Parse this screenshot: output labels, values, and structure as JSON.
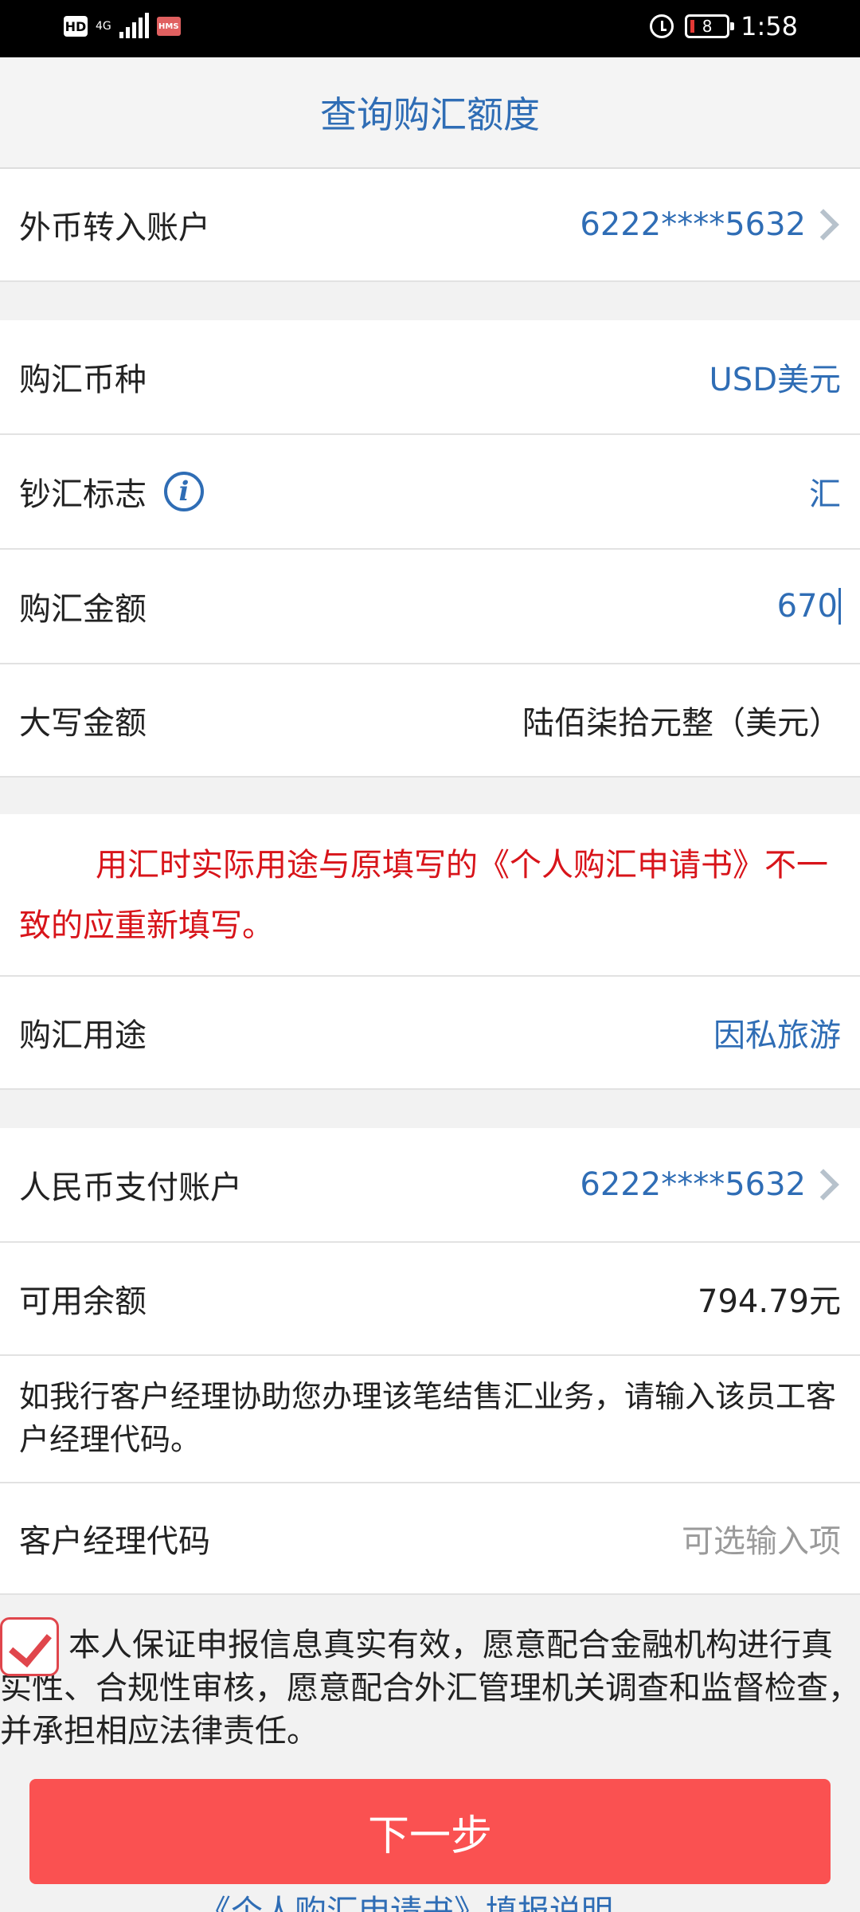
{
  "status_bar": {
    "hd": "HD",
    "network": "4G",
    "hms": "HMS",
    "battery": "8",
    "time": "1:58"
  },
  "header": {
    "title": "查询购汇额度"
  },
  "fx_account": {
    "label": "外币转入账户",
    "value": "6222****5632"
  },
  "currency": {
    "label": "购汇币种",
    "value": "USD美元"
  },
  "cash_remit_flag": {
    "label": "钞汇标志",
    "value": "汇"
  },
  "amount": {
    "label": "购汇金额",
    "value": "670"
  },
  "amount_upper": {
    "label": "大写金额",
    "value": "陆佰柒拾元整（美元）"
  },
  "notice": {
    "text": "用汇时实际用途与原填写的《个人购汇申请书》不一致的应重新填写。"
  },
  "purpose": {
    "label": "购汇用途",
    "value": "因私旅游"
  },
  "cny_account": {
    "label": "人民币支付账户",
    "value": "6222****5632"
  },
  "balance": {
    "label": "可用余额",
    "value": "794.79元"
  },
  "helper": {
    "text": "如我行客户经理协助您办理该笔结售汇业务，请输入该员工客户经理代码。"
  },
  "manager_code": {
    "label": "客户经理代码",
    "placeholder": "可选输入项"
  },
  "agreement": {
    "checked": true,
    "text": "本人保证申报信息真实有效，愿意配合金融机构进行真实性、合规性审核，愿意配合外汇管理机关调查和监督检查，并承担相应法律责任。"
  },
  "buttons": {
    "next": "下一步"
  },
  "footer": {
    "link": "《个人购汇申请书》填报说明"
  },
  "colors": {
    "accent_blue": "#2f6db5",
    "notice_red": "#d8141a",
    "button_red": "#fa5151"
  }
}
